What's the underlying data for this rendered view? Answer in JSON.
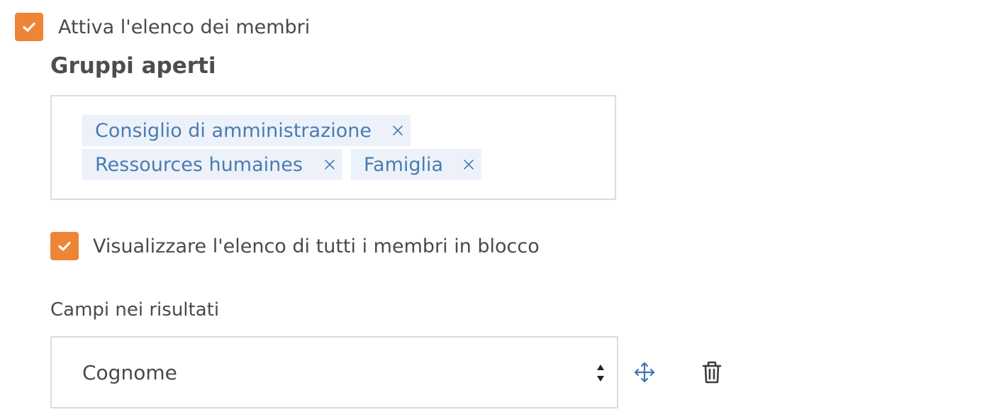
{
  "members_list": {
    "enable_checked": true,
    "enable_label": "Attiva l'elenco dei membri"
  },
  "open_groups": {
    "title": "Gruppi aperti",
    "tags": [
      {
        "label": "Consiglio di amministrazione"
      },
      {
        "label": "Ressources humaines"
      },
      {
        "label": "Famiglia"
      }
    ]
  },
  "show_all": {
    "checked": true,
    "label": "Visualizzare l'elenco di tutti i membri in blocco"
  },
  "result_fields": {
    "label": "Campi nei risultati",
    "selected_value": "Cognome",
    "move_icon": "move-arrows-icon",
    "delete_icon": "trash-icon"
  },
  "colors": {
    "accent": "#ee8536",
    "tag_text": "#4a7cb0",
    "tag_bg": "#edf2fa",
    "move_icon": "#3f76b3"
  }
}
